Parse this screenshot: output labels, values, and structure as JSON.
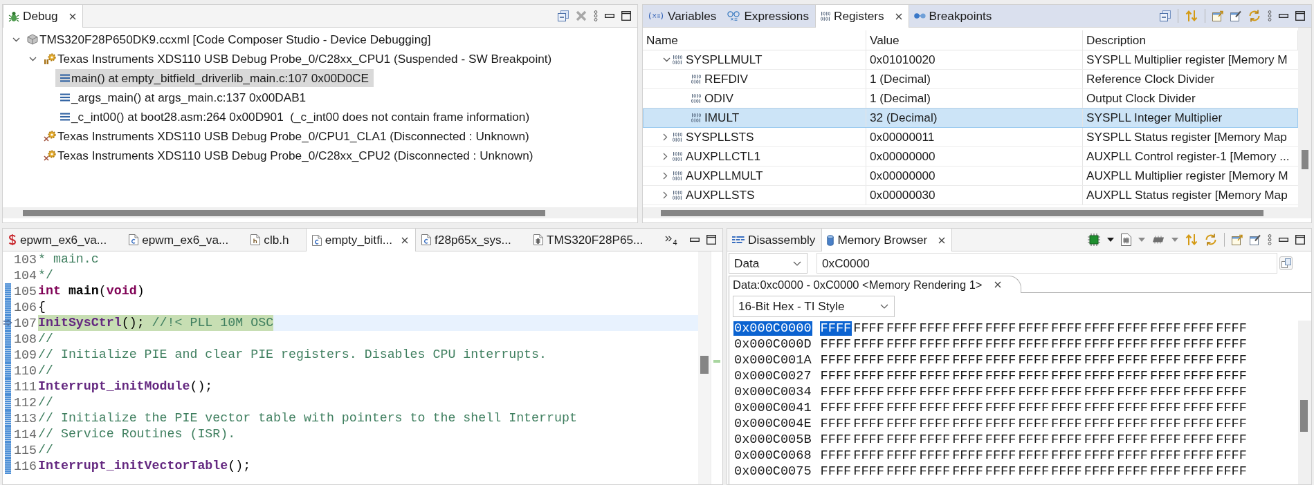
{
  "debug_view": {
    "tabs": [
      {
        "kind": "debug",
        "label": "Debug",
        "selected": true
      }
    ],
    "tree": [
      {
        "kind": "launch",
        "label": "TMS320F28P650DK9.ccxml [Code Composer Studio - Device Debugging]",
        "expanded": true,
        "selected": false,
        "children": [
          {
            "kind": "suspended",
            "label": "Texas Instruments XDS110 USB Debug Probe_0/C28xx_CPU1 (Suspended - SW Breakpoint)",
            "expanded": true,
            "selected": false,
            "children": [
              {
                "kind": "frame",
                "label": "main() at empty_bitfield_driverlib_main.c:107 0x00D0CE",
                "selected": true
              },
              {
                "kind": "frame",
                "label": "_args_main() at args_main.c:137 0x00DAB1",
                "selected": false
              },
              {
                "kind": "frame",
                "label": "_c_int00() at boot28.asm:264 0x00D901  (_c_int00 does not contain frame information)",
                "selected": false
              }
            ]
          },
          {
            "kind": "disconnected",
            "label": "Texas Instruments XDS110 USB Debug Probe_0/CPU1_CLA1 (Disconnected : Unknown)",
            "selected": false
          },
          {
            "kind": "disconnected",
            "label": "Texas Instruments XDS110 USB Debug Probe_0/C28xx_CPU2 (Disconnected : Unknown)",
            "selected": false
          }
        ]
      }
    ]
  },
  "registers_view": {
    "tabs": [
      {
        "kind": "variables",
        "label": "Variables",
        "selected": false
      },
      {
        "kind": "expressions",
        "label": "Expressions",
        "selected": false
      },
      {
        "kind": "registers",
        "label": "Registers",
        "selected": true
      },
      {
        "kind": "breakpoints",
        "label": "Breakpoints",
        "selected": false
      }
    ],
    "columns": [
      "Name",
      "Value",
      "Description"
    ],
    "rows": [
      {
        "name": "SYSPLLMULT",
        "value": "0x01010020",
        "description": "SYSPLL Multiplier register [Memory M",
        "expanded": true,
        "selected": false,
        "children": [
          {
            "name": "REFDIV",
            "value": "1 (Decimal)",
            "description": "Reference Clock Divider",
            "selected": false
          },
          {
            "name": "ODIV",
            "value": "1 (Decimal)",
            "description": "Output Clock Divider",
            "selected": false
          },
          {
            "name": "IMULT",
            "value": "32 (Decimal)",
            "description": "SYSPLL Integer Multiplier",
            "selected": true
          }
        ]
      },
      {
        "name": "SYSPLLSTS",
        "value": "0x00000011",
        "description": "SYSPLL Status register [Memory Map",
        "expanded": false,
        "selected": false
      },
      {
        "name": "AUXPLLCTL1",
        "value": "0x00000000",
        "description": "AUXPLL Control register-1 [Memory ...",
        "expanded": false,
        "selected": false
      },
      {
        "name": "AUXPLLMULT",
        "value": "0x00000000",
        "description": "AUXPLL Multiplier register [Memory M",
        "expanded": false,
        "selected": false
      },
      {
        "name": "AUXPLLSTS",
        "value": "0x00000030",
        "description": "AUXPLL Status register [Memory Map",
        "expanded": false,
        "selected": false
      }
    ]
  },
  "editor": {
    "tabs": [
      {
        "kind": "asm",
        "label": "epwm_ex6_va...",
        "selected": false
      },
      {
        "kind": "c",
        "label": "epwm_ex6_va...",
        "selected": false
      },
      {
        "kind": "h",
        "label": "clb.h",
        "selected": false
      },
      {
        "kind": "c",
        "label": "empty_bitfi...",
        "selected": true
      },
      {
        "kind": "c",
        "label": "f28p65x_sys...",
        "selected": false
      },
      {
        "kind": "ccxml",
        "label": "TMS320F28P65...",
        "selected": false
      }
    ],
    "overflow_count": "4",
    "lines": [
      {
        "number": "103",
        "changed": false,
        "current": false,
        "tokens": [
          {
            "kind": "comment",
            "text": "* main.c"
          }
        ]
      },
      {
        "number": "104",
        "changed": false,
        "current": false,
        "tokens": [
          {
            "kind": "comment",
            "text": "*/"
          }
        ]
      },
      {
        "number": "105",
        "changed": true,
        "current": false,
        "tokens": [
          {
            "kind": "keyword",
            "text": "int "
          },
          {
            "kind": "declaration",
            "text": "main"
          },
          {
            "kind": "plain",
            "text": "("
          },
          {
            "kind": "keyword",
            "text": "void"
          },
          {
            "kind": "plain",
            "text": ")"
          }
        ]
      },
      {
        "number": "106",
        "changed": true,
        "current": false,
        "tokens": [
          {
            "kind": "plain",
            "text": "{"
          }
        ]
      },
      {
        "number": "107",
        "changed": true,
        "current": true,
        "tokens": [
          {
            "kind": "function",
            "text": "InitSysCtrl"
          },
          {
            "kind": "plain",
            "text": "(); "
          },
          {
            "kind": "comment",
            "text": "//!< PLL 10M OSC"
          }
        ]
      },
      {
        "number": "108",
        "changed": true,
        "current": false,
        "tokens": [
          {
            "kind": "comment",
            "text": "//"
          }
        ]
      },
      {
        "number": "109",
        "changed": true,
        "current": false,
        "tokens": [
          {
            "kind": "comment",
            "text": "// Initialize PIE and clear PIE registers. Disables CPU interrupts."
          }
        ]
      },
      {
        "number": "110",
        "changed": true,
        "current": false,
        "tokens": [
          {
            "kind": "comment",
            "text": "//"
          }
        ]
      },
      {
        "number": "111",
        "changed": true,
        "current": false,
        "tokens": [
          {
            "kind": "function",
            "text": "Interrupt_initModule"
          },
          {
            "kind": "plain",
            "text": "();"
          }
        ]
      },
      {
        "number": "112",
        "changed": true,
        "current": false,
        "tokens": [
          {
            "kind": "comment",
            "text": "//"
          }
        ]
      },
      {
        "number": "113",
        "changed": true,
        "current": false,
        "tokens": [
          {
            "kind": "comment",
            "text": "// Initialize the PIE vector table with pointers to the shell Interrupt"
          }
        ]
      },
      {
        "number": "114",
        "changed": true,
        "current": false,
        "tokens": [
          {
            "kind": "comment",
            "text": "// Service Routines (ISR)."
          }
        ]
      },
      {
        "number": "115",
        "changed": true,
        "current": false,
        "tokens": [
          {
            "kind": "comment",
            "text": "//"
          }
        ]
      },
      {
        "number": "116",
        "changed": true,
        "current": false,
        "tokens": [
          {
            "kind": "function",
            "text": "Interrupt_initVectorTable"
          },
          {
            "kind": "plain",
            "text": "();"
          }
        ]
      }
    ]
  },
  "memory_browser": {
    "tabs": [
      {
        "kind": "disassembly",
        "label": "Disassembly",
        "selected": false
      },
      {
        "kind": "memory",
        "label": "Memory Browser",
        "selected": true
      }
    ],
    "memory_space": "Data",
    "address": "0xC0000",
    "rendering_tabs": [
      {
        "label": "Data:0xc0000 - 0xC0000 <Memory Rendering 1>",
        "selected": true
      }
    ],
    "format": "16-Bit Hex - TI Style",
    "rows": [
      {
        "address": "0x000C0000",
        "selected": true,
        "cells": [
          {
            "value": "FFFF",
            "selected": true
          },
          {
            "value": "FFFF",
            "selected": false
          },
          {
            "value": "FFFF",
            "selected": false
          },
          {
            "value": "FFFF",
            "selected": false
          },
          {
            "value": "FFFF",
            "selected": false
          },
          {
            "value": "FFFF",
            "selected": false
          },
          {
            "value": "FFFF",
            "selected": false
          },
          {
            "value": "FFFF",
            "selected": false
          },
          {
            "value": "FFFF",
            "selected": false
          },
          {
            "value": "FFFF",
            "selected": false
          },
          {
            "value": "FFFF",
            "selected": false
          },
          {
            "value": "FFFF",
            "selected": false
          },
          {
            "value": "FFFF",
            "selected": false
          }
        ]
      },
      {
        "address": "0x000C000D",
        "selected": false,
        "cells": [
          {
            "value": "FFFF",
            "selected": false
          },
          {
            "value": "FFFF",
            "selected": false
          },
          {
            "value": "FFFF",
            "selected": false
          },
          {
            "value": "FFFF",
            "selected": false
          },
          {
            "value": "FFFF",
            "selected": false
          },
          {
            "value": "FFFF",
            "selected": false
          },
          {
            "value": "FFFF",
            "selected": false
          },
          {
            "value": "FFFF",
            "selected": false
          },
          {
            "value": "FFFF",
            "selected": false
          },
          {
            "value": "FFFF",
            "selected": false
          },
          {
            "value": "FFFF",
            "selected": false
          },
          {
            "value": "FFFF",
            "selected": false
          },
          {
            "value": "FFFF",
            "selected": false
          }
        ]
      },
      {
        "address": "0x000C001A",
        "selected": false,
        "cells": [
          {
            "value": "FFFF",
            "selected": false
          },
          {
            "value": "FFFF",
            "selected": false
          },
          {
            "value": "FFFF",
            "selected": false
          },
          {
            "value": "FFFF",
            "selected": false
          },
          {
            "value": "FFFF",
            "selected": false
          },
          {
            "value": "FFFF",
            "selected": false
          },
          {
            "value": "FFFF",
            "selected": false
          },
          {
            "value": "FFFF",
            "selected": false
          },
          {
            "value": "FFFF",
            "selected": false
          },
          {
            "value": "FFFF",
            "selected": false
          },
          {
            "value": "FFFF",
            "selected": false
          },
          {
            "value": "FFFF",
            "selected": false
          },
          {
            "value": "FFFF",
            "selected": false
          }
        ]
      },
      {
        "address": "0x000C0027",
        "selected": false,
        "cells": [
          {
            "value": "FFFF",
            "selected": false
          },
          {
            "value": "FFFF",
            "selected": false
          },
          {
            "value": "FFFF",
            "selected": false
          },
          {
            "value": "FFFF",
            "selected": false
          },
          {
            "value": "FFFF",
            "selected": false
          },
          {
            "value": "FFFF",
            "selected": false
          },
          {
            "value": "FFFF",
            "selected": false
          },
          {
            "value": "FFFF",
            "selected": false
          },
          {
            "value": "FFFF",
            "selected": false
          },
          {
            "value": "FFFF",
            "selected": false
          },
          {
            "value": "FFFF",
            "selected": false
          },
          {
            "value": "FFFF",
            "selected": false
          },
          {
            "value": "FFFF",
            "selected": false
          }
        ]
      },
      {
        "address": "0x000C0034",
        "selected": false,
        "cells": [
          {
            "value": "FFFF",
            "selected": false
          },
          {
            "value": "FFFF",
            "selected": false
          },
          {
            "value": "FFFF",
            "selected": false
          },
          {
            "value": "FFFF",
            "selected": false
          },
          {
            "value": "FFFF",
            "selected": false
          },
          {
            "value": "FFFF",
            "selected": false
          },
          {
            "value": "FFFF",
            "selected": false
          },
          {
            "value": "FFFF",
            "selected": false
          },
          {
            "value": "FFFF",
            "selected": false
          },
          {
            "value": "FFFF",
            "selected": false
          },
          {
            "value": "FFFF",
            "selected": false
          },
          {
            "value": "FFFF",
            "selected": false
          },
          {
            "value": "FFFF",
            "selected": false
          }
        ]
      },
      {
        "address": "0x000C0041",
        "selected": false,
        "cells": [
          {
            "value": "FFFF",
            "selected": false
          },
          {
            "value": "FFFF",
            "selected": false
          },
          {
            "value": "FFFF",
            "selected": false
          },
          {
            "value": "FFFF",
            "selected": false
          },
          {
            "value": "FFFF",
            "selected": false
          },
          {
            "value": "FFFF",
            "selected": false
          },
          {
            "value": "FFFF",
            "selected": false
          },
          {
            "value": "FFFF",
            "selected": false
          },
          {
            "value": "FFFF",
            "selected": false
          },
          {
            "value": "FFFF",
            "selected": false
          },
          {
            "value": "FFFF",
            "selected": false
          },
          {
            "value": "FFFF",
            "selected": false
          },
          {
            "value": "FFFF",
            "selected": false
          }
        ]
      },
      {
        "address": "0x000C004E",
        "selected": false,
        "cells": [
          {
            "value": "FFFF",
            "selected": false
          },
          {
            "value": "FFFF",
            "selected": false
          },
          {
            "value": "FFFF",
            "selected": false
          },
          {
            "value": "FFFF",
            "selected": false
          },
          {
            "value": "FFFF",
            "selected": false
          },
          {
            "value": "FFFF",
            "selected": false
          },
          {
            "value": "FFFF",
            "selected": false
          },
          {
            "value": "FFFF",
            "selected": false
          },
          {
            "value": "FFFF",
            "selected": false
          },
          {
            "value": "FFFF",
            "selected": false
          },
          {
            "value": "FFFF",
            "selected": false
          },
          {
            "value": "FFFF",
            "selected": false
          },
          {
            "value": "FFFF",
            "selected": false
          }
        ]
      },
      {
        "address": "0x000C005B",
        "selected": false,
        "cells": [
          {
            "value": "FFFF",
            "selected": false
          },
          {
            "value": "FFFF",
            "selected": false
          },
          {
            "value": "FFFF",
            "selected": false
          },
          {
            "value": "FFFF",
            "selected": false
          },
          {
            "value": "FFFF",
            "selected": false
          },
          {
            "value": "FFFF",
            "selected": false
          },
          {
            "value": "FFFF",
            "selected": false
          },
          {
            "value": "FFFF",
            "selected": false
          },
          {
            "value": "FFFF",
            "selected": false
          },
          {
            "value": "FFFF",
            "selected": false
          },
          {
            "value": "FFFF",
            "selected": false
          },
          {
            "value": "FFFF",
            "selected": false
          },
          {
            "value": "FFFF",
            "selected": false
          }
        ]
      },
      {
        "address": "0x000C0068",
        "selected": false,
        "cells": [
          {
            "value": "FFFF",
            "selected": false
          },
          {
            "value": "FFFF",
            "selected": false
          },
          {
            "value": "FFFF",
            "selected": false
          },
          {
            "value": "FFFF",
            "selected": false
          },
          {
            "value": "FFFF",
            "selected": false
          },
          {
            "value": "FFFF",
            "selected": false
          },
          {
            "value": "FFFF",
            "selected": false
          },
          {
            "value": "FFFF",
            "selected": false
          },
          {
            "value": "FFFF",
            "selected": false
          },
          {
            "value": "FFFF",
            "selected": false
          },
          {
            "value": "FFFF",
            "selected": false
          },
          {
            "value": "FFFF",
            "selected": false
          },
          {
            "value": "FFFF",
            "selected": false
          }
        ]
      },
      {
        "address": "0x000C0075",
        "selected": false,
        "cells": [
          {
            "value": "FFFF",
            "selected": false
          },
          {
            "value": "FFFF",
            "selected": false
          },
          {
            "value": "FFFF",
            "selected": false
          },
          {
            "value": "FFFF",
            "selected": false
          },
          {
            "value": "FFFF",
            "selected": false
          },
          {
            "value": "FFFF",
            "selected": false
          },
          {
            "value": "FFFF",
            "selected": false
          },
          {
            "value": "FFFF",
            "selected": false
          },
          {
            "value": "FFFF",
            "selected": false
          },
          {
            "value": "FFFF",
            "selected": false
          },
          {
            "value": "FFFF",
            "selected": false
          },
          {
            "value": "FFFF",
            "selected": false
          },
          {
            "value": "FFFF",
            "selected": false
          }
        ]
      }
    ]
  }
}
